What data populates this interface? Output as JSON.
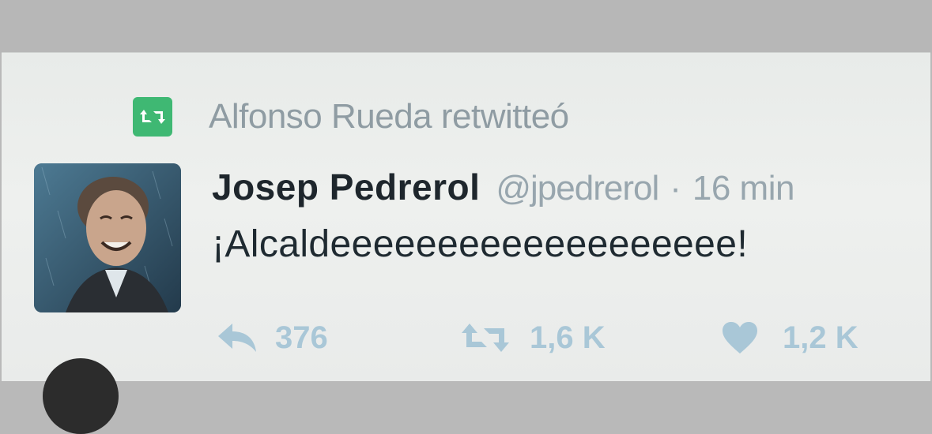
{
  "retweet_context": {
    "label": "Alfonso Rueda retwitteó"
  },
  "tweet": {
    "author_name": "Josep Pedrerol",
    "author_handle": "@jpedrerol",
    "separator": "·",
    "time": "16 min",
    "text": "¡Alcaldeeeeeeeeeeeeeeeeeee!"
  },
  "actions": {
    "reply": {
      "icon": "reply-icon",
      "count": "376"
    },
    "retweet": {
      "icon": "retweet-icon",
      "count": "1,6 K"
    },
    "like": {
      "icon": "heart-icon",
      "count": "1,2 K"
    }
  },
  "colors": {
    "retweet_badge": "#3fb873",
    "action_icons": "#a9c7d7",
    "secondary_text": "#98a6ae"
  }
}
